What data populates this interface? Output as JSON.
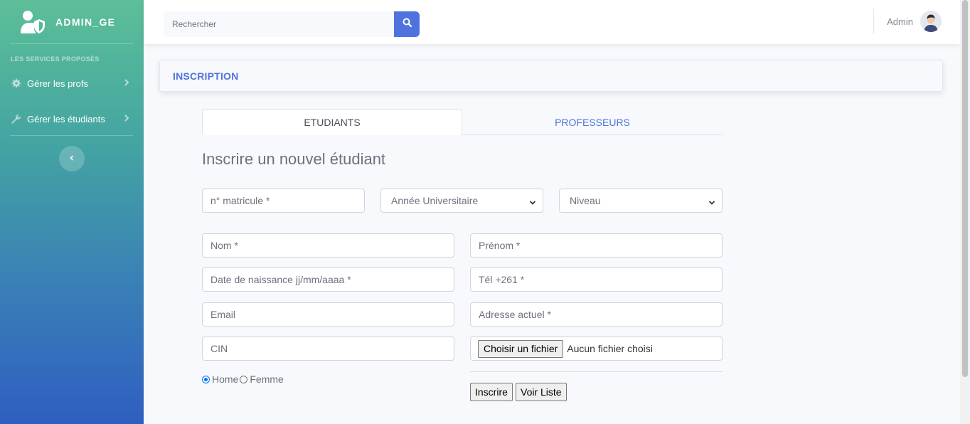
{
  "sidebar": {
    "brand": "ADMIN_GE",
    "brand_icon": "user-shield-icon",
    "heading": "LES SERVICES PROPOSÉS",
    "items": [
      {
        "label": "Gérer les profs",
        "icon": "gear-icon"
      },
      {
        "label": "Gérer les étudiants",
        "icon": "wrench-icon"
      }
    ],
    "toggle_icon": "chevron-left-icon",
    "gradient": [
      "#5cbf97",
      "#2f5ec0"
    ]
  },
  "topbar": {
    "search_placeholder": "Rechercher",
    "search_icon": "search-icon",
    "user_name": "Admin",
    "accent": "#4e73df"
  },
  "card": {
    "title": "INSCRIPTION"
  },
  "tabs": [
    {
      "label": "ETUDIANTS",
      "active": true
    },
    {
      "label": "PROFESSEURS",
      "active": false
    }
  ],
  "form": {
    "title": "Inscrire un nouvel étudiant",
    "matricule_placeholder": "n° matricule *",
    "annee_selected": "Année Universitaire",
    "niveau_selected": "Niveau",
    "nom_placeholder": "Nom *",
    "prenom_placeholder": "Prénom *",
    "naissance_placeholder": "Date de naissance jj/mm/aaaa *",
    "tel_placeholder": "Tél +261 *",
    "email_placeholder": "Email",
    "adresse_placeholder": "Adresse actuel *",
    "cin_placeholder": "CIN",
    "file_button": "Choisir un fichier",
    "file_status": "Aucun fichier choisi",
    "gender_options": [
      {
        "label": "Home",
        "checked": true
      },
      {
        "label": "Femme",
        "checked": false
      }
    ],
    "submit_label": "Inscrire",
    "list_label": "Voir Liste"
  }
}
